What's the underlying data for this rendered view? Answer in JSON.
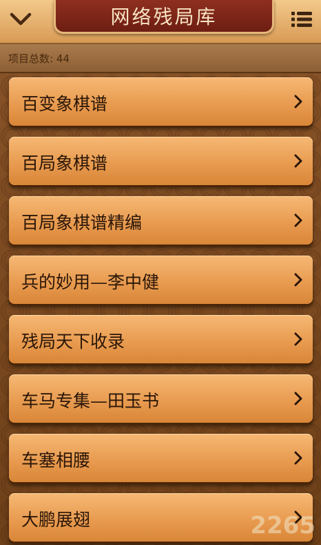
{
  "header": {
    "title": "网络残局库",
    "back_icon": "chevron-down-icon",
    "menu_icon": "list-menu-icon"
  },
  "info": {
    "count_text": "项目总数: 44"
  },
  "items": [
    {
      "label": "百变象棋谱"
    },
    {
      "label": "百局象棋谱"
    },
    {
      "label": "百局象棋谱精编"
    },
    {
      "label": "兵的妙用—李中健"
    },
    {
      "label": "残局天下收录"
    },
    {
      "label": "车马专集—田玉书"
    },
    {
      "label": "车塞相腰"
    },
    {
      "label": "大鹏展翅"
    }
  ],
  "watermark": "2265"
}
